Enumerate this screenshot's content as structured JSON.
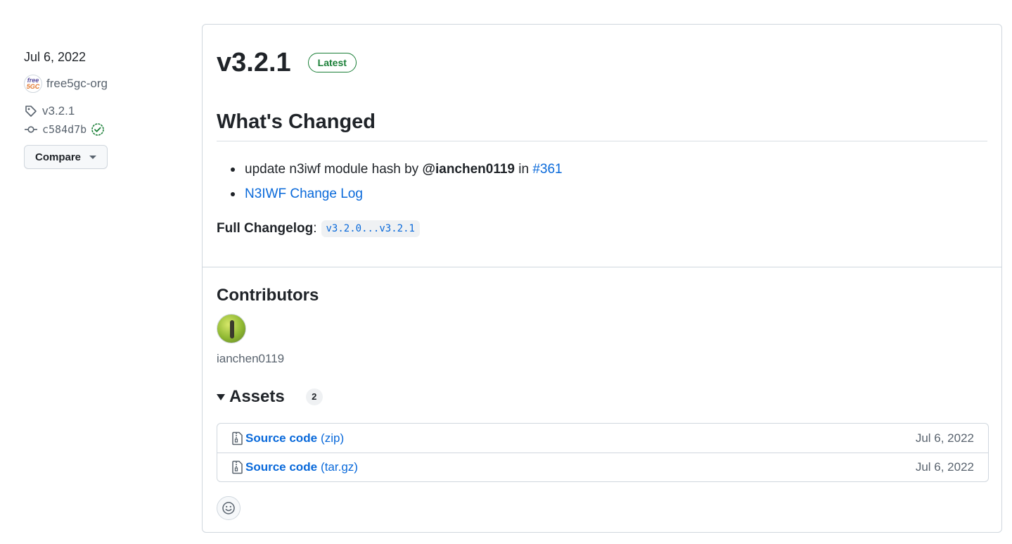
{
  "sidebar": {
    "date": "Jul 6, 2022",
    "org_avatar_text": [
      "free",
      "5GC"
    ],
    "org_name": "free5gc-org",
    "tag": "v3.2.1",
    "commit": "c584d7b",
    "compare_label": "Compare",
    "icons": {
      "tag": "tag-icon",
      "commit": "git-commit-icon",
      "verified": "verified-check-icon",
      "caret": "caret-down-icon"
    }
  },
  "release": {
    "title": "v3.2.1",
    "badge": "Latest",
    "changes_heading": "What's Changed",
    "items": [
      {
        "text": "update n3iwf module hash by ",
        "user": "@ianchen0119",
        "mid": " in ",
        "pr": "#361"
      },
      {
        "link": "N3IWF Change Log"
      }
    ],
    "full_changelog_label": "Full Changelog",
    "full_changelog_sep": ":",
    "full_changelog_range": "v3.2.0...v3.2.1"
  },
  "contributors": {
    "heading": "Contributors",
    "names": [
      "ianchen0119"
    ]
  },
  "assets": {
    "heading": "Assets",
    "count": "2",
    "items": [
      {
        "name": "Source code",
        "ext": "(zip)",
        "date": "Jul 6, 2022"
      },
      {
        "name": "Source code",
        "ext": "(tar.gz)",
        "date": "Jul 6, 2022"
      }
    ]
  },
  "colors": {
    "link": "#0969da",
    "latest": "#1a7f37",
    "border": "#d0d7de",
    "muted": "#59636e"
  }
}
